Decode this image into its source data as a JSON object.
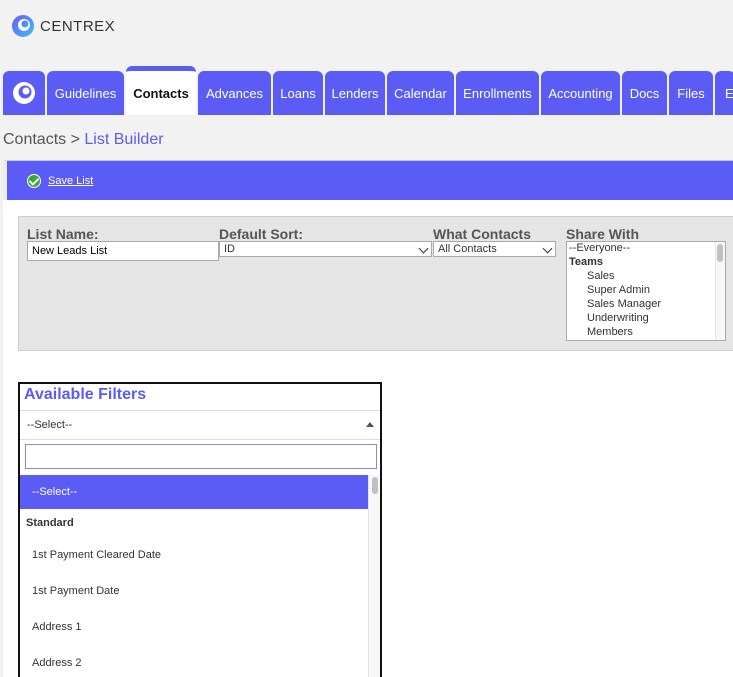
{
  "logo": {
    "text": "CENTREX"
  },
  "tabs": [
    {
      "label": "Guidelines",
      "active": false
    },
    {
      "label": "Contacts",
      "active": true
    },
    {
      "label": "Advances",
      "active": false
    },
    {
      "label": "Loans",
      "active": false
    },
    {
      "label": "Lenders",
      "active": false
    },
    {
      "label": "Calendar",
      "active": false
    },
    {
      "label": "Enrollments",
      "active": false
    },
    {
      "label": "Accounting",
      "active": false
    },
    {
      "label": "Docs",
      "active": false
    },
    {
      "label": "Files",
      "active": false
    },
    {
      "label": "E",
      "active": false
    }
  ],
  "breadcrumb": {
    "parent": "Contacts",
    "separator": ">",
    "current": "List Builder"
  },
  "actionbar": {
    "save_label": "Save List"
  },
  "form": {
    "list_name_label": "List Name:",
    "list_name_value": "New Leads List",
    "default_sort_label": "Default Sort:",
    "default_sort_value": "ID",
    "what_contacts_label": "What Contacts",
    "what_contacts_value": "All Contacts",
    "share_with_label": "Share With",
    "share_with_options": [
      {
        "label": "--Everyone--",
        "kind": "option"
      },
      {
        "label": "Teams",
        "kind": "group"
      },
      {
        "label": "Sales",
        "kind": "child"
      },
      {
        "label": "Super Admin",
        "kind": "child"
      },
      {
        "label": "Sales Manager",
        "kind": "child"
      },
      {
        "label": "Underwriting",
        "kind": "child"
      },
      {
        "label": "Members",
        "kind": "child"
      }
    ]
  },
  "filters": {
    "title": "Available Filters",
    "selected": "--Select--",
    "search_value": "",
    "options": [
      {
        "label": "--Select--",
        "kind": "selected"
      },
      {
        "label": "Standard",
        "kind": "group"
      },
      {
        "label": "1st Payment Cleared Date",
        "kind": "option"
      },
      {
        "label": "1st Payment Date",
        "kind": "option"
      },
      {
        "label": "Address 1",
        "kind": "option"
      },
      {
        "label": "Address 2",
        "kind": "option"
      }
    ]
  },
  "colors": {
    "accent": "#5b5bf5",
    "save_icon": "#3aa63a"
  }
}
